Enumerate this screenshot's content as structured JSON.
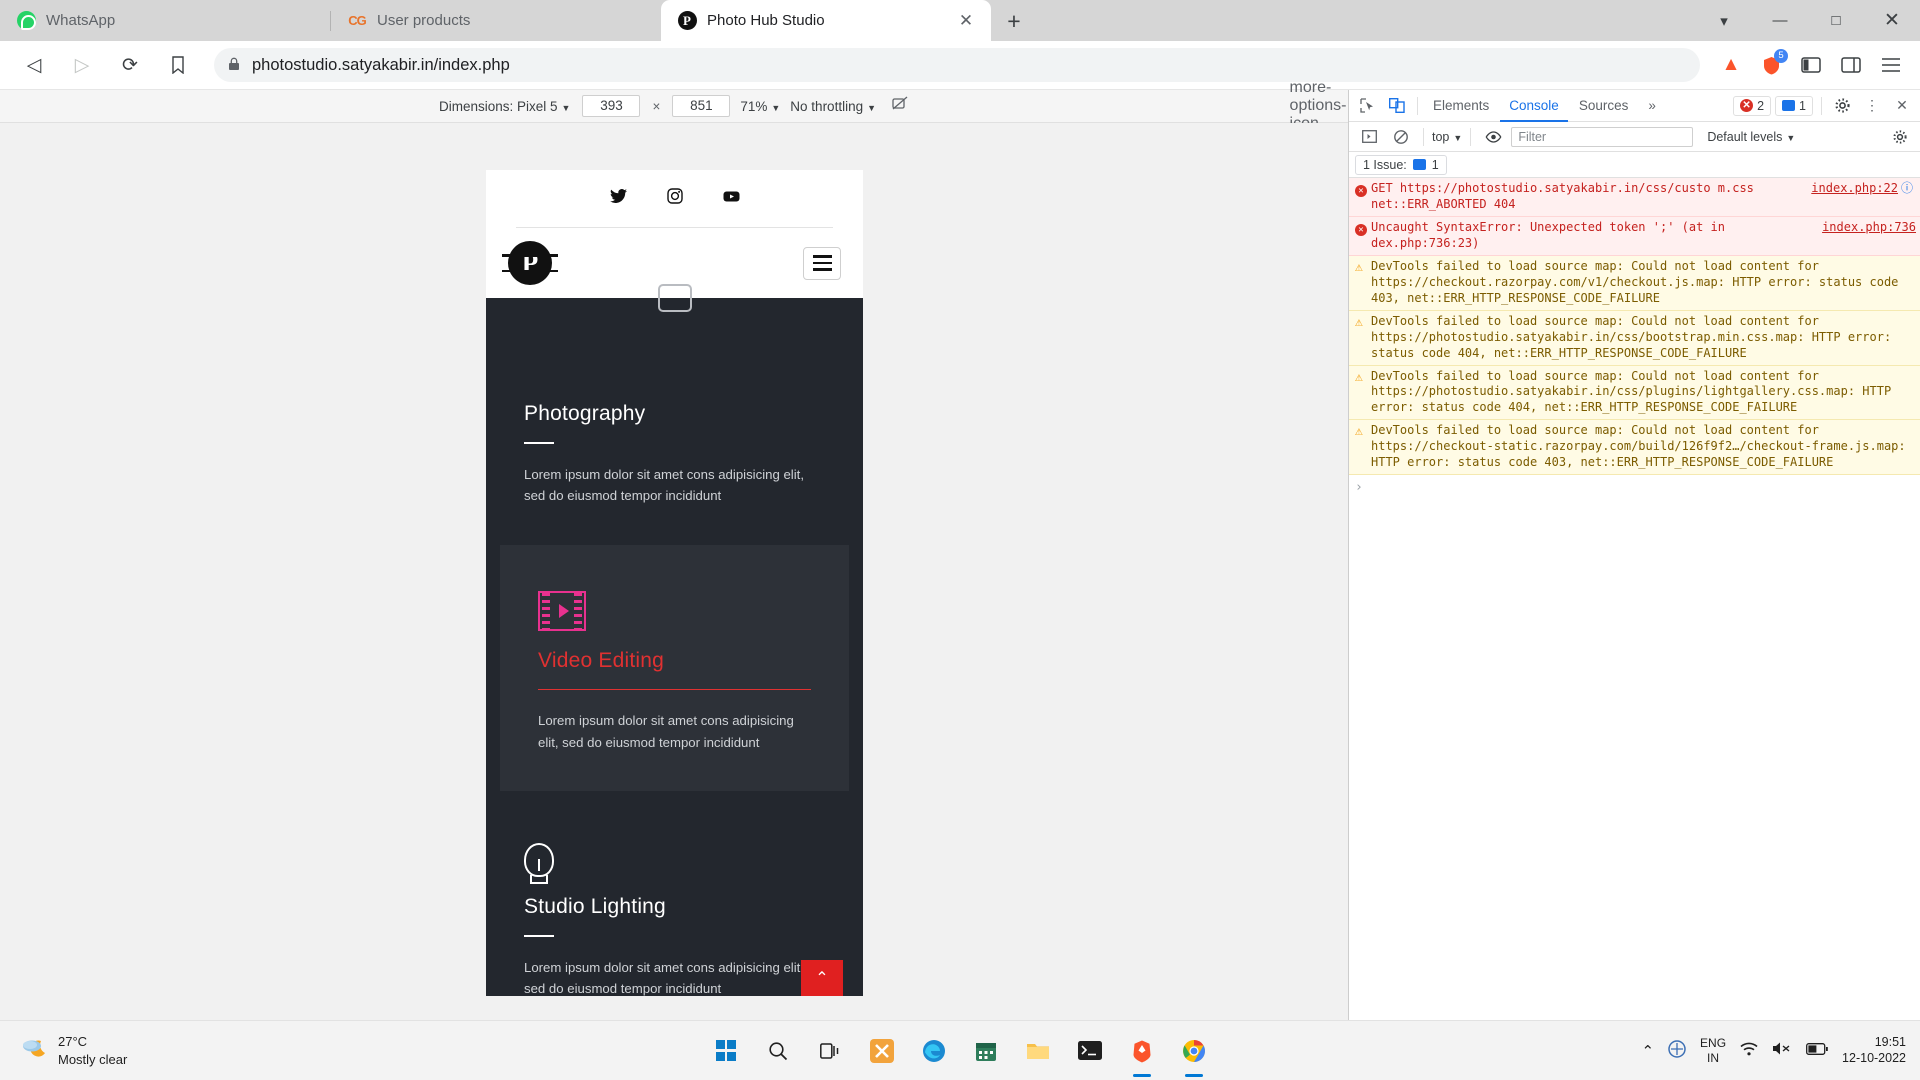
{
  "browser": {
    "tabs": [
      {
        "title": "WhatsApp",
        "icon": "whatsapp-icon",
        "active": false
      },
      {
        "title": "User products",
        "icon": "cg-icon",
        "active": false
      },
      {
        "title": "Photo Hub Studio",
        "icon": "photo-hub-icon",
        "active": true
      }
    ],
    "new_tab_label": "+",
    "window_controls": {
      "minimize": "—",
      "maximize": "□",
      "close": "✕",
      "more_tabs": "▾"
    },
    "toolbar": {
      "back": "◁",
      "forward": "▷",
      "reload": "⟳",
      "bookmark": "ὑ6",
      "url": "photostudio.satyakabir.in/index.php",
      "lock_icon": "lock-icon",
      "brave_shield_count": "5",
      "menu_icon": "hamburger-menu-icon"
    }
  },
  "device_toolbar": {
    "dimensions_label": "Dimensions: Pixel 5",
    "width": "393",
    "height": "851",
    "times": "×",
    "zoom": "71%",
    "throttling": "No throttling",
    "rotate_icon": "rotate-icon",
    "more_icon": "more-options-icon"
  },
  "page": {
    "social": [
      {
        "name": "twitter-icon",
        "glyph": "🐦"
      },
      {
        "name": "instagram-icon",
        "glyph": "▣"
      },
      {
        "name": "youtube-icon",
        "glyph": "▶"
      }
    ],
    "logo_letter": "P",
    "services": [
      {
        "title": "Photography",
        "text": "Lorem ipsum dolor sit amet cons adipisicing elit, sed do eiusmod tempor incididunt",
        "active": false,
        "icon": "camera-icon"
      },
      {
        "title": "Video Editing",
        "text": "Lorem ipsum dolor sit amet cons adipisicing elit, sed do eiusmod tempor incididunt",
        "active": true,
        "icon": "film-strip-icon"
      },
      {
        "title": "Studio Lighting",
        "text": "Lorem ipsum dolor sit amet cons adipisicing elit, sed do eiusmod tempor incididunt",
        "active": false,
        "icon": "lightbulb-icon"
      }
    ],
    "back_to_top": "⌃"
  },
  "devtools": {
    "tabs": [
      {
        "label": "Elements",
        "active": false
      },
      {
        "label": "Console",
        "active": true
      },
      {
        "label": "Sources",
        "active": false
      }
    ],
    "more_tabs": "»",
    "error_count": "2",
    "message_count": "1",
    "settings_icon": "gear-icon",
    "more_icon": "more-options-icon",
    "close_icon": "close-icon",
    "inspect_icon": "inspect-element-icon",
    "device_icon": "toggle-device-toolbar-icon",
    "sub_toolbar": {
      "sidebar_icon": "console-sidebar-icon",
      "clear_icon": "clear-console-icon",
      "context": "top",
      "eye_icon": "live-expression-icon",
      "filter_placeholder": "Filter",
      "levels": "Default levels",
      "settings_icon": "console-settings-icon"
    },
    "issue_bar": {
      "label": "1 Issue:",
      "count": "1",
      "icon": "issue-icon"
    },
    "messages": [
      {
        "level": "error",
        "text": "GET https://photostudio.satyakabir.in/css/custo m.css net::ERR_ABORTED 404",
        "source": "index.php:22",
        "has_network_icon": true
      },
      {
        "level": "error",
        "text": "Uncaught SyntaxError: Unexpected token ';' (at in dex.php:736:23)",
        "source": "index.php:736",
        "has_network_icon": false
      },
      {
        "level": "warn",
        "text": "DevTools failed to load source map: Could not load content for https://checkout.razorpay.com/v1/checkout.js.map: HTTP error: status code 403, net::ERR_HTTP_RESPONSE_CODE_FAILURE",
        "source": "",
        "has_network_icon": false
      },
      {
        "level": "warn",
        "text": "DevTools failed to load source map: Could not load content for https://photostudio.satyakabir.in/css/bootstrap.min.css.map: HTTP error: status code 404, net::ERR_HTTP_RESPONSE_CODE_FAILURE",
        "source": "",
        "has_network_icon": false
      },
      {
        "level": "warn",
        "text": "DevTools failed to load source map: Could not load content for https://photostudio.satyakabir.in/css/plugins/lightgallery.css.map: HTTP error: status code 404, net::ERR_HTTP_RESPONSE_CODE_FAILURE",
        "source": "",
        "has_network_icon": false
      },
      {
        "level": "warn",
        "text": "DevTools failed to load source map: Could not load content for https://checkout-static.razorpay.com/build/126f9f2…/checkout-frame.js.map: HTTP error: status code 403, net::ERR_HTTP_RESPONSE_CODE_FAILURE",
        "source": "",
        "has_network_icon": false
      }
    ],
    "prompt_symbol": "›"
  },
  "taskbar": {
    "weather": {
      "temperature": "27°C",
      "condition": "Mostly clear",
      "icon": "partly-cloudy-night-icon"
    },
    "apps": [
      {
        "name": "start-button",
        "glyph": ""
      },
      {
        "name": "search-icon",
        "glyph": "⌕"
      },
      {
        "name": "task-view-icon",
        "glyph": "◧"
      },
      {
        "name": "app-icon-orange",
        "glyph": "⌨"
      },
      {
        "name": "edge-icon",
        "glyph": "◔"
      },
      {
        "name": "calendar-icon",
        "glyph": "▤"
      },
      {
        "name": "file-explorer-icon",
        "glyph": "🗀"
      },
      {
        "name": "terminal-icon",
        "glyph": "▸"
      },
      {
        "name": "brave-icon",
        "glyph": "◆"
      },
      {
        "name": "chrome-icon",
        "glyph": "◯"
      }
    ],
    "tray": {
      "chevron": "⌃",
      "app_icon": "tray-app-icon",
      "language_line1": "ENG",
      "language_line2": "IN",
      "wifi_icon": "wifi-icon",
      "volume_icon": "volume-muted-icon",
      "battery_icon": "battery-icon",
      "time": "19:51",
      "date": "12-10-2022"
    }
  },
  "colors": {
    "accent_blue": "#1a73e8",
    "error_red": "#d93025",
    "warn_yellow": "#f29900",
    "brand_red": "#e03131",
    "pink": "#e8318f",
    "dark_bg": "#23272e"
  }
}
